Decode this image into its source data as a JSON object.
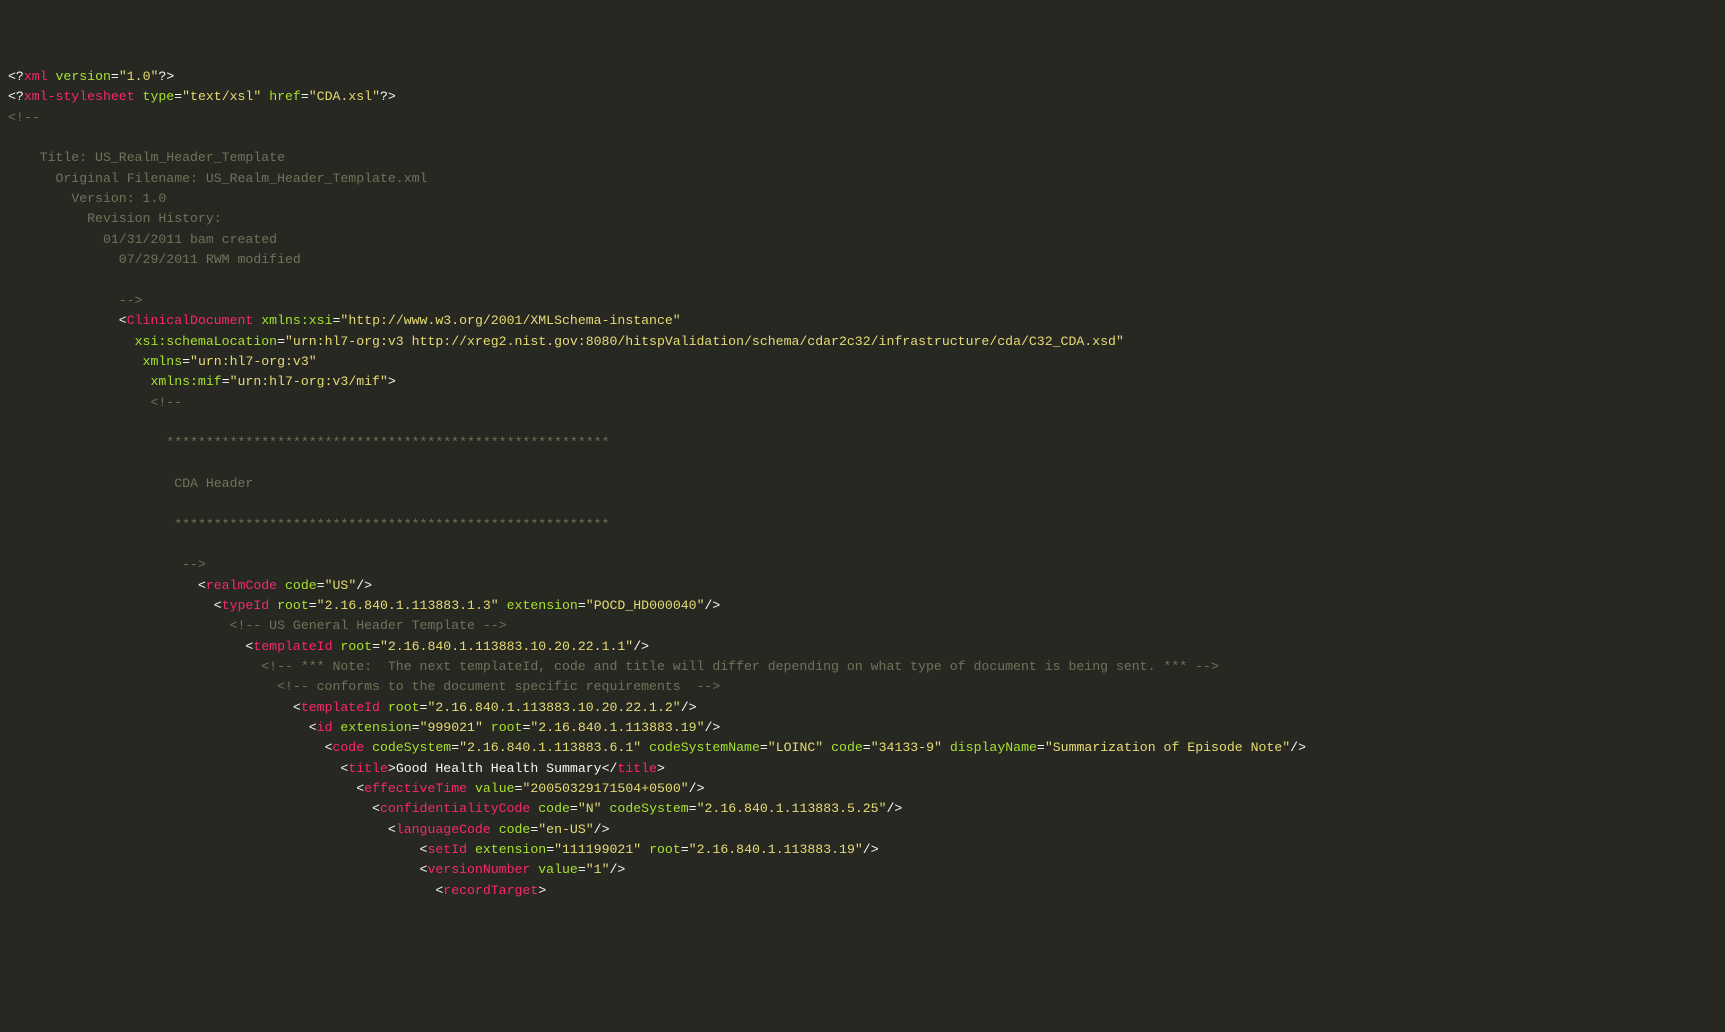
{
  "lines": [
    {
      "pad": 0,
      "seg": [
        [
          "w",
          "<?"
        ],
        [
          "p",
          "xml"
        ],
        [
          "c",
          " "
        ],
        [
          "a",
          "version"
        ],
        [
          "w",
          "="
        ],
        [
          "s",
          "\"1.0\""
        ],
        [
          "w",
          "?>"
        ]
      ]
    },
    {
      "pad": 0,
      "seg": [
        [
          "w",
          "<?"
        ],
        [
          "p",
          "xml-stylesheet"
        ],
        [
          "c",
          " "
        ],
        [
          "a",
          "type"
        ],
        [
          "w",
          "="
        ],
        [
          "s",
          "\"text/xsl\""
        ],
        [
          "c",
          " "
        ],
        [
          "a",
          "href"
        ],
        [
          "w",
          "="
        ],
        [
          "s",
          "\"CDA.xsl\""
        ],
        [
          "w",
          "?>"
        ]
      ]
    },
    {
      "pad": 0,
      "seg": [
        [
          "c",
          "<!--"
        ]
      ]
    },
    {
      "pad": 0,
      "seg": [
        [
          "c",
          ""
        ]
      ]
    },
    {
      "pad": 4,
      "seg": [
        [
          "c",
          "Title: US_Realm_Header_Template"
        ]
      ]
    },
    {
      "pad": 6,
      "seg": [
        [
          "c",
          "Original Filename: US_Realm_Header_Template.xml"
        ]
      ]
    },
    {
      "pad": 8,
      "seg": [
        [
          "c",
          "Version: 1.0"
        ]
      ]
    },
    {
      "pad": 10,
      "seg": [
        [
          "c",
          "Revision History:"
        ]
      ]
    },
    {
      "pad": 12,
      "seg": [
        [
          "c",
          "01/31/2011 bam created"
        ]
      ]
    },
    {
      "pad": 14,
      "seg": [
        [
          "c",
          "07/29/2011 RWM modified"
        ]
      ]
    },
    {
      "pad": 0,
      "seg": [
        [
          "c",
          ""
        ]
      ]
    },
    {
      "pad": 14,
      "seg": [
        [
          "c",
          "-->"
        ]
      ]
    },
    {
      "pad": 14,
      "seg": [
        [
          "w",
          "<"
        ],
        [
          "p",
          "ClinicalDocument"
        ],
        [
          "c",
          " "
        ],
        [
          "a",
          "xmlns:xsi"
        ],
        [
          "w",
          "="
        ],
        [
          "s",
          "\"http://www.w3.org/2001/XMLSchema-instance\""
        ]
      ]
    },
    {
      "pad": 16,
      "seg": [
        [
          "a",
          "xsi:schemaLocation"
        ],
        [
          "w",
          "="
        ],
        [
          "s",
          "\"urn:hl7-org:v3 http://xreg2.nist.gov:8080/hitspValidation/schema/cdar2c32/infrastructure/cda/C32_CDA.xsd\""
        ]
      ]
    },
    {
      "pad": 17,
      "seg": [
        [
          "a",
          "xmlns"
        ],
        [
          "w",
          "="
        ],
        [
          "s",
          "\"urn:hl7-org:v3\""
        ]
      ]
    },
    {
      "pad": 18,
      "seg": [
        [
          "a",
          "xmlns:mif"
        ],
        [
          "w",
          "="
        ],
        [
          "s",
          "\"urn:hl7-org:v3/mif\""
        ],
        [
          "w",
          ">"
        ]
      ]
    },
    {
      "pad": 18,
      "seg": [
        [
          "c",
          "<!--"
        ]
      ]
    },
    {
      "pad": 0,
      "seg": [
        [
          "c",
          ""
        ]
      ]
    },
    {
      "pad": 20,
      "seg": [
        [
          "c",
          "********************************************************"
        ]
      ]
    },
    {
      "pad": 0,
      "seg": [
        [
          "c",
          ""
        ]
      ]
    },
    {
      "pad": 21,
      "seg": [
        [
          "c",
          "CDA Header"
        ]
      ]
    },
    {
      "pad": 0,
      "seg": [
        [
          "c",
          ""
        ]
      ]
    },
    {
      "pad": 21,
      "seg": [
        [
          "c",
          "*******************************************************"
        ]
      ]
    },
    {
      "pad": 0,
      "seg": [
        [
          "c",
          ""
        ]
      ]
    },
    {
      "pad": 22,
      "seg": [
        [
          "c",
          "-->"
        ]
      ]
    },
    {
      "pad": 24,
      "seg": [
        [
          "w",
          "<"
        ],
        [
          "p",
          "realmCode"
        ],
        [
          "c",
          " "
        ],
        [
          "a",
          "code"
        ],
        [
          "w",
          "="
        ],
        [
          "s",
          "\"US\""
        ],
        [
          "w",
          "/>"
        ]
      ]
    },
    {
      "pad": 26,
      "seg": [
        [
          "w",
          "<"
        ],
        [
          "p",
          "typeId"
        ],
        [
          "c",
          " "
        ],
        [
          "a",
          "root"
        ],
        [
          "w",
          "="
        ],
        [
          "s",
          "\"2.16.840.1.113883.1.3\""
        ],
        [
          "c",
          " "
        ],
        [
          "a",
          "extension"
        ],
        [
          "w",
          "="
        ],
        [
          "s",
          "\"POCD_HD000040\""
        ],
        [
          "w",
          "/>"
        ]
      ]
    },
    {
      "pad": 28,
      "seg": [
        [
          "c",
          "<!-- US General Header Template -->"
        ]
      ]
    },
    {
      "pad": 30,
      "seg": [
        [
          "w",
          "<"
        ],
        [
          "p",
          "templateId"
        ],
        [
          "c",
          " "
        ],
        [
          "a",
          "root"
        ],
        [
          "w",
          "="
        ],
        [
          "s",
          "\"2.16.840.1.113883.10.20.22.1.1\""
        ],
        [
          "w",
          "/>"
        ]
      ]
    },
    {
      "pad": 32,
      "seg": [
        [
          "c",
          "<!-- *** Note:  The next templateId, code and title will differ depending on what type of document is being sent. *** -->"
        ]
      ]
    },
    {
      "pad": 34,
      "seg": [
        [
          "c",
          "<!-- conforms to the document specific requirements  -->"
        ]
      ]
    },
    {
      "pad": 36,
      "seg": [
        [
          "w",
          "<"
        ],
        [
          "p",
          "templateId"
        ],
        [
          "c",
          " "
        ],
        [
          "a",
          "root"
        ],
        [
          "w",
          "="
        ],
        [
          "s",
          "\"2.16.840.1.113883.10.20.22.1.2\""
        ],
        [
          "w",
          "/>"
        ]
      ]
    },
    {
      "pad": 38,
      "seg": [
        [
          "w",
          "<"
        ],
        [
          "p",
          "id"
        ],
        [
          "c",
          " "
        ],
        [
          "a",
          "extension"
        ],
        [
          "w",
          "="
        ],
        [
          "s",
          "\"999021\""
        ],
        [
          "c",
          " "
        ],
        [
          "a",
          "root"
        ],
        [
          "w",
          "="
        ],
        [
          "s",
          "\"2.16.840.1.113883.19\""
        ],
        [
          "w",
          "/>"
        ]
      ]
    },
    {
      "pad": 40,
      "seg": [
        [
          "w",
          "<"
        ],
        [
          "p",
          "code"
        ],
        [
          "c",
          " "
        ],
        [
          "a",
          "codeSystem"
        ],
        [
          "w",
          "="
        ],
        [
          "s",
          "\"2.16.840.1.113883.6.1\""
        ],
        [
          "c",
          " "
        ],
        [
          "a",
          "codeSystemName"
        ],
        [
          "w",
          "="
        ],
        [
          "s",
          "\"LOINC\""
        ],
        [
          "c",
          " "
        ],
        [
          "a",
          "code"
        ],
        [
          "w",
          "="
        ],
        [
          "s",
          "\"34133-9\""
        ],
        [
          "c",
          " "
        ],
        [
          "a",
          "displayName"
        ],
        [
          "w",
          "="
        ],
        [
          "s",
          "\"Summarization of Episode Note\""
        ],
        [
          "w",
          "/>"
        ]
      ]
    },
    {
      "pad": 42,
      "seg": [
        [
          "w",
          "<"
        ],
        [
          "p",
          "title"
        ],
        [
          "w",
          ">"
        ],
        [
          "w",
          "Good Health Health Summary"
        ],
        [
          "w",
          "</"
        ],
        [
          "p",
          "title"
        ],
        [
          "w",
          ">"
        ]
      ]
    },
    {
      "pad": 44,
      "seg": [
        [
          "w",
          "<"
        ],
        [
          "p",
          "effectiveTime"
        ],
        [
          "c",
          " "
        ],
        [
          "a",
          "value"
        ],
        [
          "w",
          "="
        ],
        [
          "s",
          "\"20050329171504+0500\""
        ],
        [
          "w",
          "/>"
        ]
      ]
    },
    {
      "pad": 46,
      "seg": [
        [
          "w",
          "<"
        ],
        [
          "p",
          "confidentialityCode"
        ],
        [
          "c",
          " "
        ],
        [
          "a",
          "code"
        ],
        [
          "w",
          "="
        ],
        [
          "s",
          "\"N\""
        ],
        [
          "c",
          " "
        ],
        [
          "a",
          "codeSystem"
        ],
        [
          "w",
          "="
        ],
        [
          "s",
          "\"2.16.840.1.113883.5.25\""
        ],
        [
          "w",
          "/>"
        ]
      ]
    },
    {
      "pad": 48,
      "seg": [
        [
          "w",
          "<"
        ],
        [
          "p",
          "languageCode"
        ],
        [
          "c",
          " "
        ],
        [
          "a",
          "code"
        ],
        [
          "w",
          "="
        ],
        [
          "s",
          "\"en-US\""
        ],
        [
          "w",
          "/>"
        ]
      ]
    },
    {
      "pad": 52,
      "seg": [
        [
          "w",
          "<"
        ],
        [
          "p",
          "setId"
        ],
        [
          "c",
          " "
        ],
        [
          "a",
          "extension"
        ],
        [
          "w",
          "="
        ],
        [
          "s",
          "\"111199021\""
        ],
        [
          "c",
          " "
        ],
        [
          "a",
          "root"
        ],
        [
          "w",
          "="
        ],
        [
          "s",
          "\"2.16.840.1.113883.19\""
        ],
        [
          "w",
          "/>"
        ]
      ]
    },
    {
      "pad": 52,
      "seg": [
        [
          "w",
          "<"
        ],
        [
          "p",
          "versionNumber"
        ],
        [
          "c",
          " "
        ],
        [
          "a",
          "value"
        ],
        [
          "w",
          "="
        ],
        [
          "s",
          "\"1\""
        ],
        [
          "w",
          "/>"
        ]
      ]
    },
    {
      "pad": 54,
      "seg": [
        [
          "w",
          "<"
        ],
        [
          "p",
          "recordTarget"
        ],
        [
          "w",
          ">"
        ]
      ]
    }
  ]
}
